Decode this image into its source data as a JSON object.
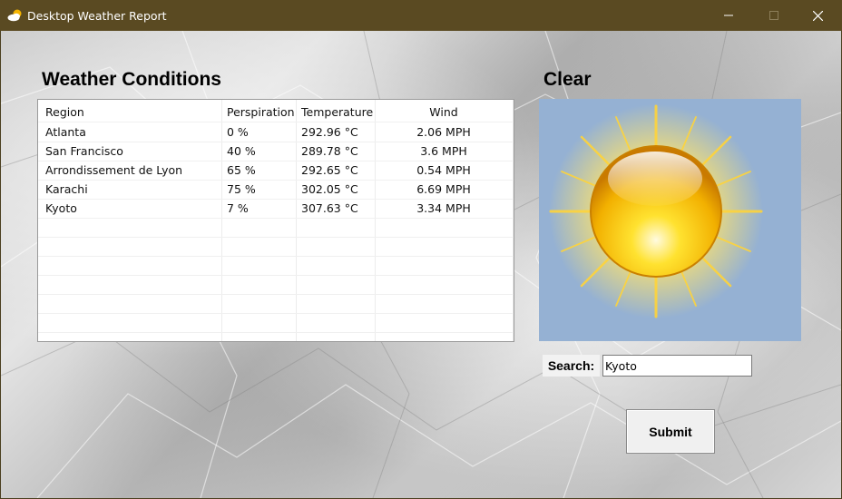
{
  "window": {
    "title": "Desktop Weather Report",
    "icon": "cloud-sun-icon"
  },
  "main": {
    "table_heading": "Weather Conditions",
    "condition_heading": "Clear",
    "table": {
      "columns": [
        "Region",
        "Perspiration",
        "Temperature",
        "Wind"
      ],
      "rows": [
        [
          "Atlanta",
          "0 %",
          "292.96 °C",
          "2.06 MPH"
        ],
        [
          "San Francisco",
          "40 %",
          "289.78 °C",
          "3.6 MPH"
        ],
        [
          "Arrondissement de Lyon",
          "65 %",
          "292.65 °C",
          "0.54 MPH"
        ],
        [
          "Karachi",
          "75 %",
          "302.05 °C",
          "6.69 MPH"
        ],
        [
          "Kyoto",
          "7 %",
          "307.63 °C",
          "3.34 MPH"
        ]
      ]
    },
    "weather_icon": "sun-icon",
    "search": {
      "label": "Search:",
      "value": "Kyoto"
    },
    "submit_label": "Submit"
  },
  "colors": {
    "titlebar": "#5a4a22",
    "image_background": "#95b1d3"
  }
}
